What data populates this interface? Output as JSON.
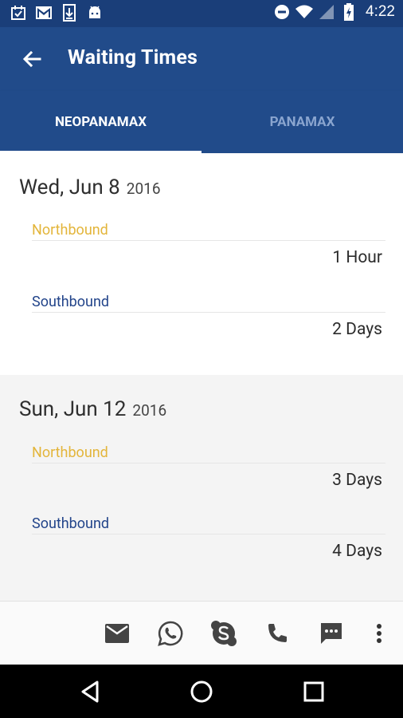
{
  "status_bar": {
    "time": "4:22"
  },
  "app_bar": {
    "title": "Waiting Times"
  },
  "tabs": [
    {
      "label": "NEOPANAMAX",
      "active": true
    },
    {
      "label": "PANAMAX",
      "active": false
    }
  ],
  "entries": [
    {
      "date": "Wed, Jun 8",
      "year": "2016",
      "northbound_label": "Northbound",
      "northbound_value": "1 Hour",
      "southbound_label": "Southbound",
      "southbound_value": "2 Days"
    },
    {
      "date": "Sun, Jun 12",
      "year": "2016",
      "northbound_label": "Northbound",
      "northbound_value": "3 Days",
      "southbound_label": "Southbound",
      "southbound_value": "4 Days"
    }
  ],
  "bottom_actions": [
    "email-icon",
    "whatsapp-icon",
    "skype-icon",
    "phone-icon",
    "sms-icon",
    "more-vert-icon"
  ],
  "colors": {
    "primary": "#214b8a",
    "status_bar": "#1a3e79",
    "northbound": "#e3b53a",
    "southbound": "#22448a"
  }
}
